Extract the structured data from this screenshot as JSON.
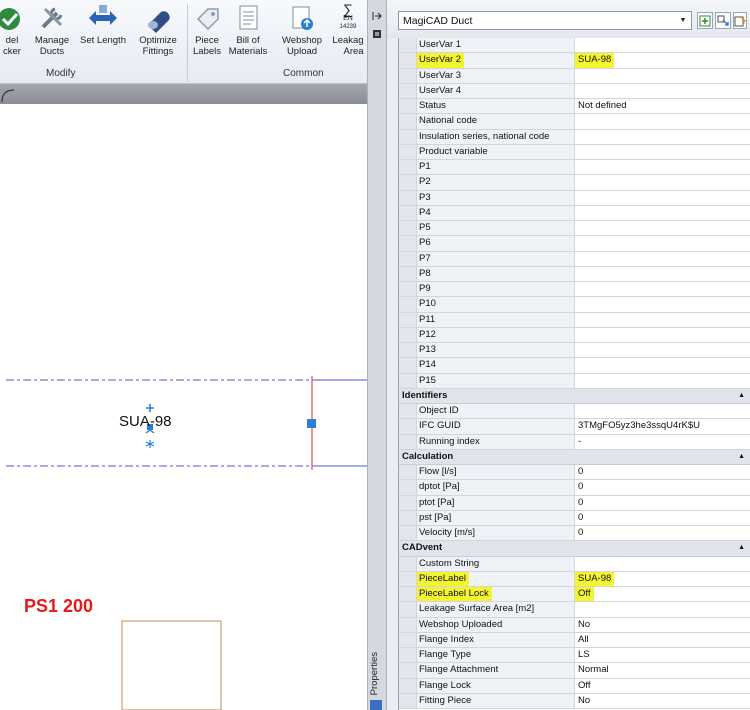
{
  "ribbon": {
    "buttons": [
      {
        "label": "del\ncker",
        "icon": "model-checker-icon"
      },
      {
        "label": "Manage\nDucts",
        "icon": "manage-ducts-icon"
      },
      {
        "label": "Set Length",
        "icon": "set-length-icon"
      },
      {
        "label": "Optimize\nFittings",
        "icon": "optimize-fittings-icon"
      },
      {
        "label": "Piece\nLabels",
        "icon": "piece-labels-icon"
      },
      {
        "label": "Bill of\nMaterials",
        "icon": "bill-of-materials-icon"
      },
      {
        "label": "Webshop\nUpload",
        "icon": "webshop-upload-icon"
      },
      {
        "label": "Leakag\nArea",
        "icon": "leakage-area-icon"
      }
    ],
    "groups": {
      "modify": "Modify",
      "common": "Common"
    },
    "leakage_icon_text": {
      "sigma": "∑",
      "en": "EN",
      "num": "14239"
    }
  },
  "drawing": {
    "piece_label": "SUA-98",
    "ps_label": "PS1 200"
  },
  "gutter": {
    "properties_label": "Properties"
  },
  "panel": {
    "object_type": "MagiCAD Duct",
    "rows_top": [
      {
        "key": "UserVar 1",
        "value": ""
      },
      {
        "key": "UserVar 2",
        "value": "SUA-98",
        "highlight": true
      },
      {
        "key": "UserVar 3",
        "value": ""
      },
      {
        "key": "UserVar 4",
        "value": ""
      },
      {
        "key": "Status",
        "value": "Not defined"
      },
      {
        "key": "National code",
        "value": ""
      },
      {
        "key": "Insulation series, national code",
        "value": ""
      },
      {
        "key": "Product variable",
        "value": ""
      },
      {
        "key": "P1",
        "value": ""
      },
      {
        "key": "P2",
        "value": ""
      },
      {
        "key": "P3",
        "value": ""
      },
      {
        "key": "P4",
        "value": ""
      },
      {
        "key": "P5",
        "value": ""
      },
      {
        "key": "P6",
        "value": ""
      },
      {
        "key": "P7",
        "value": ""
      },
      {
        "key": "P8",
        "value": ""
      },
      {
        "key": "P9",
        "value": ""
      },
      {
        "key": "P10",
        "value": ""
      },
      {
        "key": "P11",
        "value": ""
      },
      {
        "key": "P12",
        "value": ""
      },
      {
        "key": "P13",
        "value": ""
      },
      {
        "key": "P14",
        "value": ""
      },
      {
        "key": "P15",
        "value": ""
      }
    ],
    "cat_identifiers": "Identifiers",
    "rows_identifiers": [
      {
        "key": "Object ID",
        "value": ""
      },
      {
        "key": "IFC GUID",
        "value": "3TMgFO5yz3he3ssqU4rK$U"
      },
      {
        "key": "Running index",
        "value": "-"
      }
    ],
    "cat_calculation": "Calculation",
    "rows_calculation": [
      {
        "key": "Flow [l/s]",
        "value": "0"
      },
      {
        "key": "dptot [Pa]",
        "value": "0"
      },
      {
        "key": "ptot [Pa]",
        "value": "0"
      },
      {
        "key": "pst [Pa]",
        "value": "0"
      },
      {
        "key": "Velocity [m/s]",
        "value": "0"
      }
    ],
    "cat_cadvent": "CADvent",
    "rows_cadvent": [
      {
        "key": "Custom String",
        "value": ""
      },
      {
        "key": "PieceLabel",
        "value": "SUA-98",
        "highlight": true
      },
      {
        "key": "PieceLabel Lock",
        "value": "Off",
        "highlight": true
      },
      {
        "key": "Leakage Surface Area [m2]",
        "value": ""
      },
      {
        "key": "Webshop Uploaded",
        "value": "No"
      },
      {
        "key": "Flange Index",
        "value": "All"
      },
      {
        "key": "Flange Type",
        "value": "LS"
      },
      {
        "key": "Flange Attachment",
        "value": "Normal"
      },
      {
        "key": "Flange Lock",
        "value": "Off"
      },
      {
        "key": "Fitting Piece",
        "value": "No"
      }
    ]
  },
  "colors": {
    "highlight": "#f3f531",
    "ps_label": "#e8191a",
    "duct_line": "#4a55d8",
    "duct_end": "#e05a6a"
  }
}
